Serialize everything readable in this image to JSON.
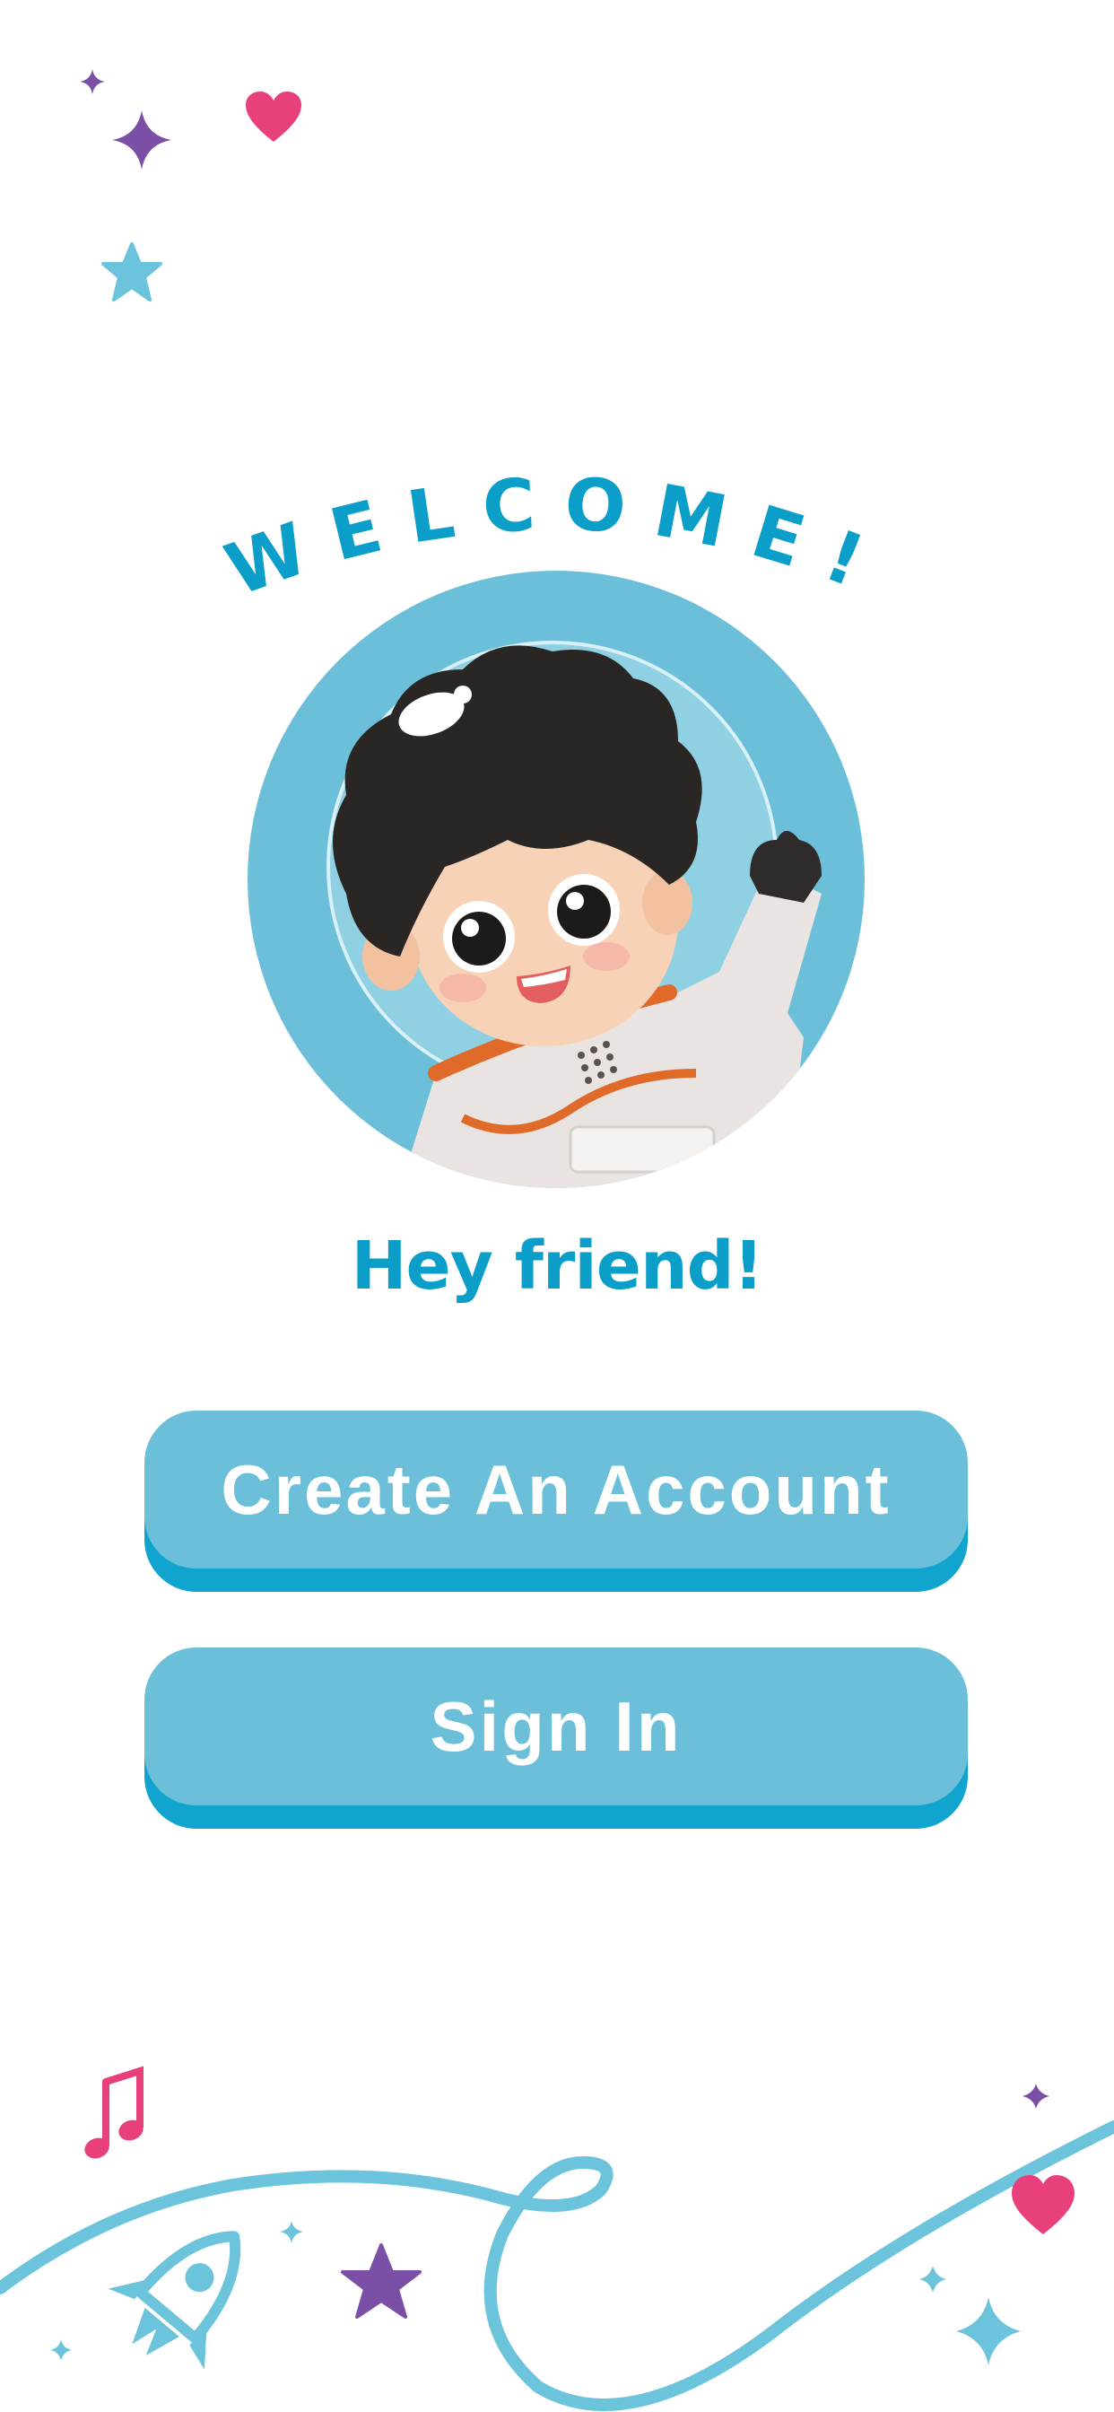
{
  "header": {
    "welcome_text": "WELCOME!"
  },
  "hero": {
    "illustration_icon": "astronaut-kid-illustration",
    "greeting": "Hey friend!"
  },
  "actions": {
    "create_account_label": "Create An Account",
    "sign_in_label": "Sign In"
  },
  "decorations": {
    "icons": [
      "sparkle-icon",
      "heart-icon",
      "star-icon",
      "music-note-icon",
      "rocket-icon"
    ]
  },
  "colors": {
    "primary": "#0a9ec9",
    "button_fill": "#6cbfd8",
    "button_shadow": "#10a4cf",
    "purple": "#7b4fa6",
    "pink": "#e8407c",
    "light_blue": "#6cc3dc"
  }
}
